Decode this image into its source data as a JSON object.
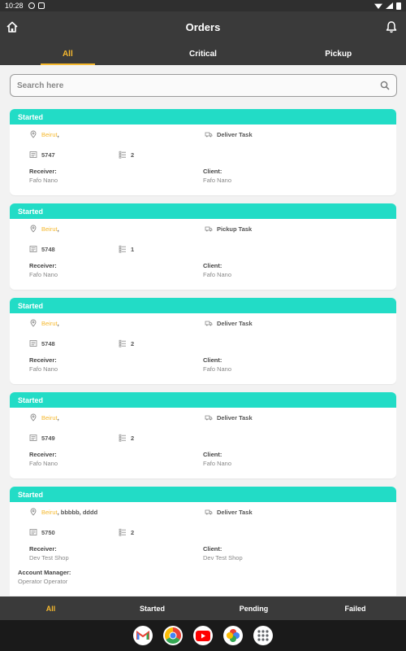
{
  "status": {
    "time": "10:28"
  },
  "header": {
    "title": "Orders"
  },
  "tabs": [
    {
      "label": "All"
    },
    {
      "label": "Critical"
    },
    {
      "label": "Pickup"
    }
  ],
  "search": {
    "placeholder": "Search here"
  },
  "labels": {
    "receiver": "Receiver:",
    "client": "Client:",
    "account_manager": "Account Manager:"
  },
  "orders": [
    {
      "status": "Started",
      "city": "Beirut",
      "address_rest": ",",
      "task": "Deliver Task",
      "id": "5747",
      "items": "2",
      "receiver": "Fafo Nano",
      "client": "Fafo Nano"
    },
    {
      "status": "Started",
      "city": "Beirut",
      "address_rest": ",",
      "task": "Pickup Task",
      "id": "5748",
      "items": "1",
      "receiver": "Fafo Nano",
      "client": "Fafo Nano"
    },
    {
      "status": "Started",
      "city": "Beirut",
      "address_rest": ",",
      "task": "Deliver Task",
      "id": "5748",
      "items": "2",
      "receiver": "Fafo Nano",
      "client": "Fafo Nano"
    },
    {
      "status": "Started",
      "city": "Beirut",
      "address_rest": ",",
      "task": "Deliver Task",
      "id": "5749",
      "items": "2",
      "receiver": "Fafo Nano",
      "client": "Fafo Nano"
    },
    {
      "status": "Started",
      "city": "Beirut",
      "address_rest": ", bbbbb, dddd",
      "task": "Deliver Task",
      "id": "5750",
      "items": "2",
      "receiver": "Dev Test Shop",
      "client": "Dev Test Shop",
      "account_manager": "Operator Operator"
    }
  ],
  "bottom_nav": [
    {
      "label": "All"
    },
    {
      "label": "Started"
    },
    {
      "label": "Pending"
    },
    {
      "label": "Failed"
    }
  ],
  "dock_apps": [
    "gmail-icon",
    "chrome-icon",
    "youtube-icon",
    "photos-icon",
    "app-drawer-icon"
  ],
  "colors": {
    "accent": "#f5b82e",
    "status_header": "#22dcc6",
    "bar": "#3a3a3a"
  }
}
